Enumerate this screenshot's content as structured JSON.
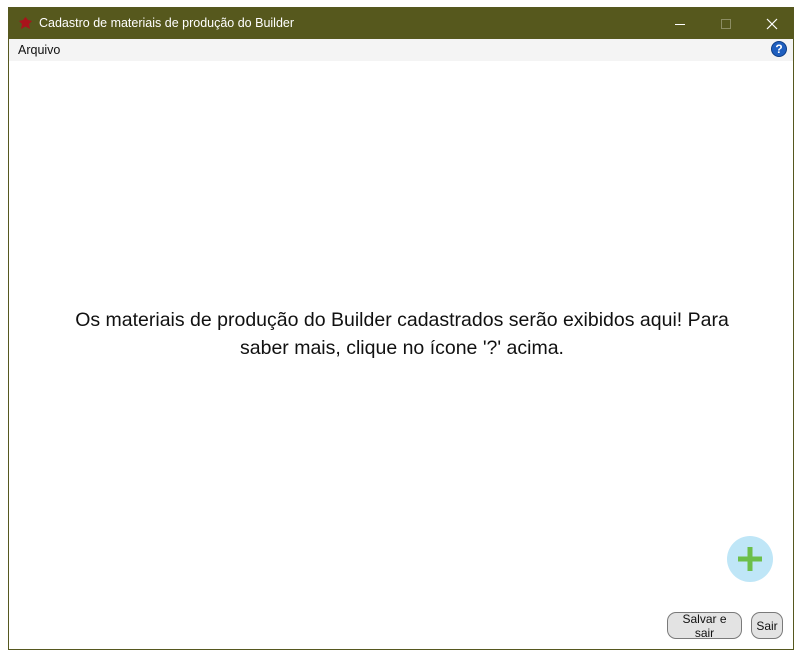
{
  "window": {
    "title": "Cadastro de materiais de produção do Builder",
    "colors": {
      "titlebar": "#56581d",
      "accent": "#1f5fbf",
      "add_button_bg": "#bfe6f7",
      "add_icon": "#6cbf4a"
    },
    "controls": {
      "minimize_icon": "minimize-icon",
      "maximize_icon": "maximize-icon",
      "close_icon": "close-icon"
    }
  },
  "menubar": {
    "items": [
      {
        "label": "Arquivo"
      }
    ],
    "help_icon": "?"
  },
  "main": {
    "empty_message": "Os materiais de produção do Builder cadastrados serão exibidos aqui! Para saber mais, clique no ícone '?' acima."
  },
  "footer": {
    "save_exit_label": "Salvar e sair",
    "exit_label": "Sair"
  }
}
